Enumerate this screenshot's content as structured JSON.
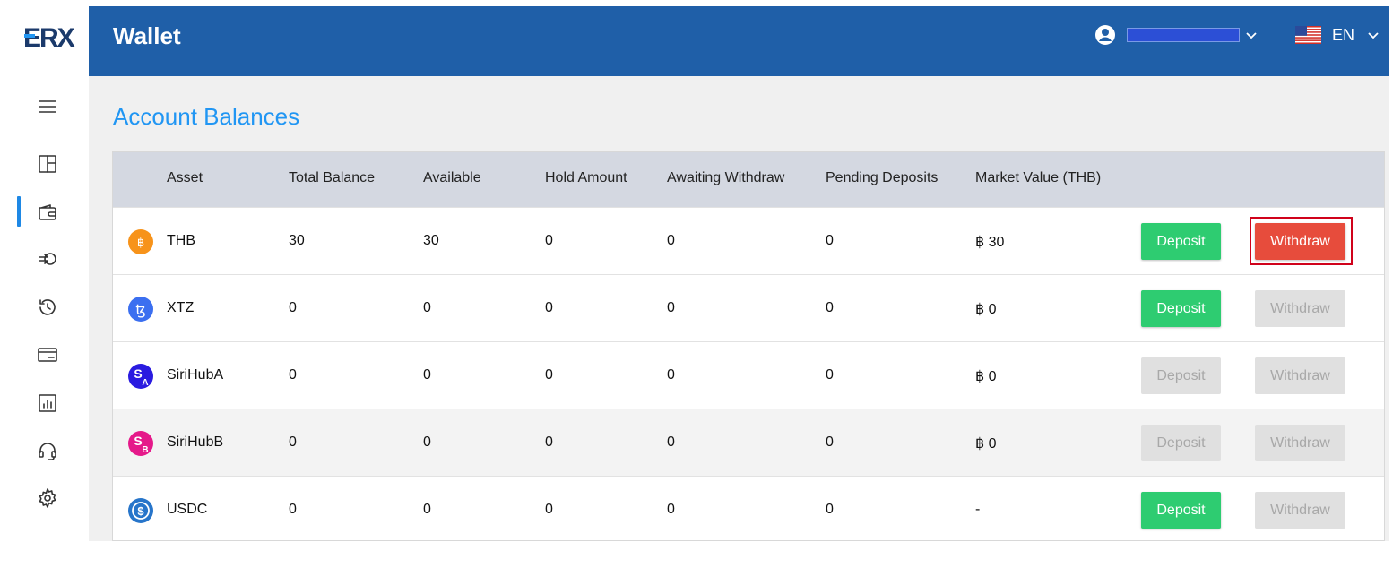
{
  "app": {
    "logo_text": "ERX",
    "header_title": "Wallet"
  },
  "user": {
    "name": ""
  },
  "language": {
    "label": "EN"
  },
  "page": {
    "title": "Account Balances"
  },
  "colors": {
    "header": "#1f5fa8",
    "accent": "#2196f3",
    "deposit": "#2ecc71",
    "withdraw": "#e74c3c",
    "highlight": "#d0021b"
  },
  "sidebar": {
    "items": [
      {
        "name": "menu",
        "icon": "hamburger-icon"
      },
      {
        "name": "dashboard",
        "icon": "layout-icon"
      },
      {
        "name": "wallet",
        "icon": "wallet-icon",
        "active": true
      },
      {
        "name": "transfer",
        "icon": "exchange-icon"
      },
      {
        "name": "history",
        "icon": "history-icon"
      },
      {
        "name": "bank",
        "icon": "bank-card-icon"
      },
      {
        "name": "reports",
        "icon": "chart-icon"
      },
      {
        "name": "support",
        "icon": "headset-icon"
      },
      {
        "name": "settings",
        "icon": "gear-icon"
      }
    ]
  },
  "table": {
    "columns": [
      "Asset",
      "Total Balance",
      "Available",
      "Hold Amount",
      "Awaiting Withdraw",
      "Pending Deposits",
      "Market Value (THB)"
    ],
    "deposit_label": "Deposit",
    "withdraw_label": "Withdraw",
    "rows": [
      {
        "asset": "THB",
        "icon": "baht-coin-icon",
        "total": "30",
        "available": "30",
        "hold": "0",
        "awaiting": "0",
        "pending": "0",
        "market": "฿ 30",
        "deposit_enabled": true,
        "withdraw_enabled": true,
        "withdraw_highlighted": true
      },
      {
        "asset": "XTZ",
        "icon": "tezos-coin-icon",
        "total": "0",
        "available": "0",
        "hold": "0",
        "awaiting": "0",
        "pending": "0",
        "market": "฿ 0",
        "deposit_enabled": true,
        "withdraw_enabled": false
      },
      {
        "asset": "SiriHubA",
        "icon": "sirihuba-coin-icon",
        "total": "0",
        "available": "0",
        "hold": "0",
        "awaiting": "0",
        "pending": "0",
        "market": "฿ 0",
        "deposit_enabled": false,
        "withdraw_enabled": false
      },
      {
        "asset": "SiriHubB",
        "icon": "sirihubb-coin-icon",
        "total": "0",
        "available": "0",
        "hold": "0",
        "awaiting": "0",
        "pending": "0",
        "market": "฿ 0",
        "deposit_enabled": false,
        "withdraw_enabled": false
      },
      {
        "asset": "USDC",
        "icon": "usdc-coin-icon",
        "total": "0",
        "available": "0",
        "hold": "0",
        "awaiting": "0",
        "pending": "0",
        "market": "-",
        "deposit_enabled": true,
        "withdraw_enabled": false
      }
    ]
  }
}
